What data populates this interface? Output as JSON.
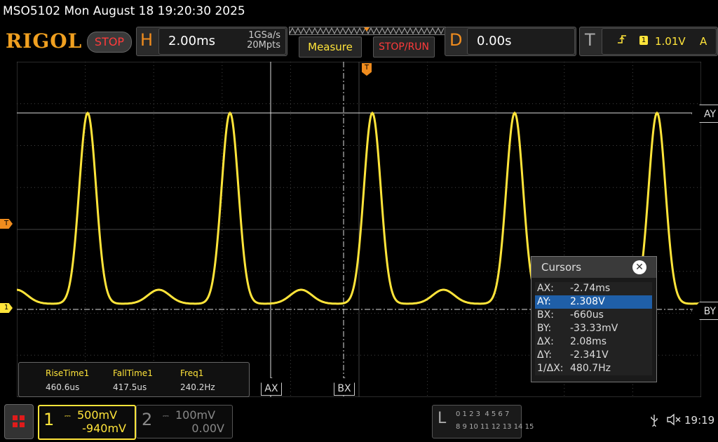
{
  "window": {
    "title": "MSO5102  Mon August 18 19:20:30 2025"
  },
  "brand": {
    "logo": "RIGOL"
  },
  "run_state": {
    "label": "STOP"
  },
  "horizontal": {
    "letter": "H",
    "scale": "2.00ms",
    "sample_rate": "1GSa/s",
    "memory_depth": "20Mpts"
  },
  "toolbar": {
    "measure_label": "Measure",
    "stop_run_label": "STOP/RUN"
  },
  "delay": {
    "letter": "D",
    "value": "0.00s"
  },
  "trigger": {
    "letter": "T",
    "edge_icon": "rising-edge-icon",
    "channel": "1",
    "level": "1.01V",
    "mode": "A"
  },
  "markers": {
    "trigger_level": "T",
    "channel1": "1",
    "trigger_pos": "T"
  },
  "cursor_tags": {
    "ax": "AX",
    "bx": "BX",
    "ay": "AY",
    "by": "BY"
  },
  "measurements": [
    {
      "label": "RiseTime1",
      "value": "460.6us"
    },
    {
      "label": "FallTime1",
      "value": "417.5us"
    },
    {
      "label": "Freq1",
      "value": "240.2Hz"
    }
  ],
  "cursors_dialog": {
    "title": "Cursors",
    "close_glyph": "✕",
    "rows": [
      {
        "key": "AX:",
        "value": "-2.74ms",
        "selected": false
      },
      {
        "key": "AY:",
        "value": "2.308V",
        "selected": true
      },
      {
        "key": "BX:",
        "value": "-660us",
        "selected": false
      },
      {
        "key": "BY:",
        "value": "-33.33mV",
        "selected": false
      },
      {
        "key": "ΔX:",
        "value": "2.08ms",
        "selected": false
      },
      {
        "key": "ΔY:",
        "value": "-2.341V",
        "selected": false
      },
      {
        "key": "1/ΔX:",
        "value": "480.7Hz",
        "selected": false
      }
    ]
  },
  "channels": {
    "ch1": {
      "number": "1",
      "scale": "500mV",
      "offset": "-940mV",
      "color": "#ffe43a"
    },
    "ch2": {
      "number": "2",
      "scale": "100mV",
      "offset": "0.00V",
      "color": "#888888"
    }
  },
  "logic": {
    "letter": "L",
    "row1": "0 1 2 3  4 5 6 7",
    "row2": "8 9 10 11 12 13 14 15"
  },
  "status": {
    "usb_icon": "usb-icon",
    "speaker_icon": "speaker-muted-icon",
    "time": "19:19"
  },
  "trace": {
    "color": "#ffe43a",
    "pulse_period_ms": 4.16,
    "time_per_div_ms": 2.0
  }
}
